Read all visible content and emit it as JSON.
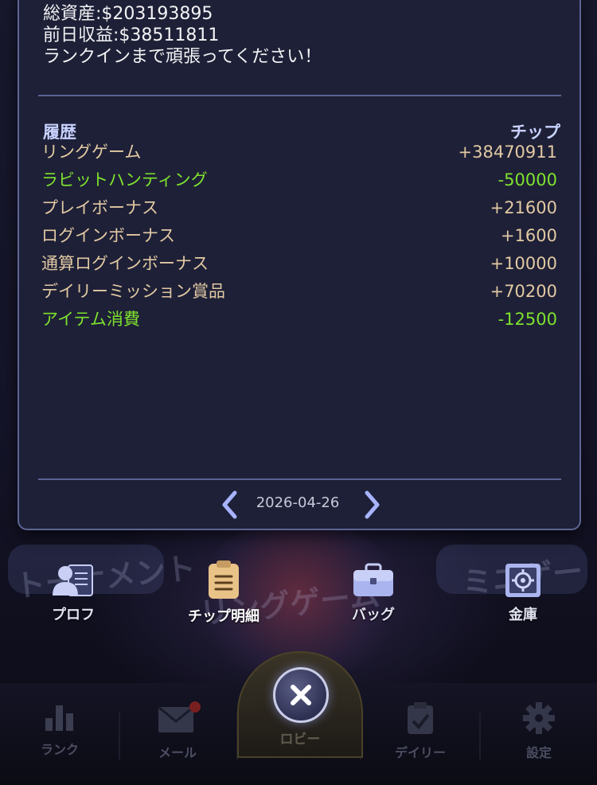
{
  "summary": {
    "total_assets": "総資産:$203193895",
    "yesterday_income": "前日収益:$38511811",
    "message": "ランクインまで頑張ってください！"
  },
  "history": {
    "header_left": "履歴",
    "header_right": "チップ",
    "rows": [
      {
        "name": "リングゲーム",
        "value": "+38470911",
        "kind": "positive"
      },
      {
        "name": "ラビットハンティング",
        "value": "-50000",
        "kind": "negative"
      },
      {
        "name": "プレイボーナス",
        "value": "+21600",
        "kind": "positive"
      },
      {
        "name": "ログインボーナス",
        "value": "+1600",
        "kind": "positive"
      },
      {
        "name": "通算ログインボーナス",
        "value": "+10000",
        "kind": "positive"
      },
      {
        "name": "デイリーミッション賞品",
        "value": "+70200",
        "kind": "positive"
      },
      {
        "name": "アイテム消費",
        "value": "-12500",
        "kind": "negative"
      }
    ]
  },
  "pager": {
    "date": "2026-04-26"
  },
  "menu": {
    "profile": "プロフ",
    "chip_detail": "チップ明細",
    "bag": "バッグ",
    "safe": "金庫"
  },
  "background_labels": {
    "tournament": "トーナメント",
    "ring_game": "リングゲーム",
    "mini": "ミニゲー"
  },
  "tabbar": {
    "rank": "ランク",
    "mail": "メール",
    "lobby": "ロビー",
    "daily": "デイリー",
    "settings": "設定"
  },
  "colors": {
    "positive": "#e2c9a3",
    "negative": "#7ee22e",
    "header": "#c8d2ff",
    "panel": "#1e2037",
    "accent_gold": "#e9c288"
  }
}
